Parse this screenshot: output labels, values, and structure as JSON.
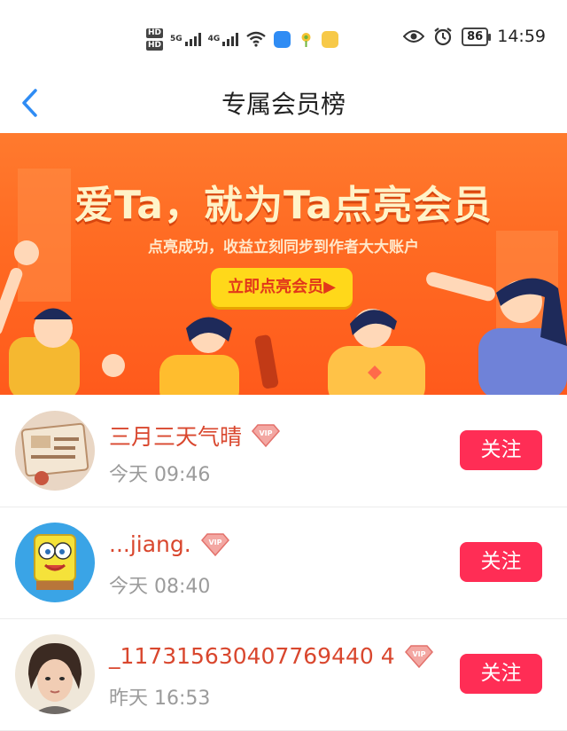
{
  "status_bar": {
    "hd1": "HD",
    "hd2": "HD",
    "net1": "5G",
    "net2": "4G",
    "battery": "86",
    "time": "14:59"
  },
  "header": {
    "title": "专属会员榜"
  },
  "banner": {
    "headline": "爱Ta，就为Ta点亮会员",
    "subtitle": "点亮成功，收益立刻同步到作者大大账户",
    "cta": "立即点亮会员▶"
  },
  "members": [
    {
      "name": "三月三天气晴",
      "time": "今天 09:46",
      "follow": "关注",
      "vip": "VIP"
    },
    {
      "name": "...jiang.",
      "time": "今天 08:40",
      "follow": "关注",
      "vip": "VIP"
    },
    {
      "name": "_117315630407769440 4",
      "time": "昨天 16:53",
      "follow": "关注",
      "vip": "VIP"
    }
  ],
  "colors": {
    "accent": "#ff2d55",
    "name": "#d9472e",
    "banner": "#ff6a22"
  }
}
